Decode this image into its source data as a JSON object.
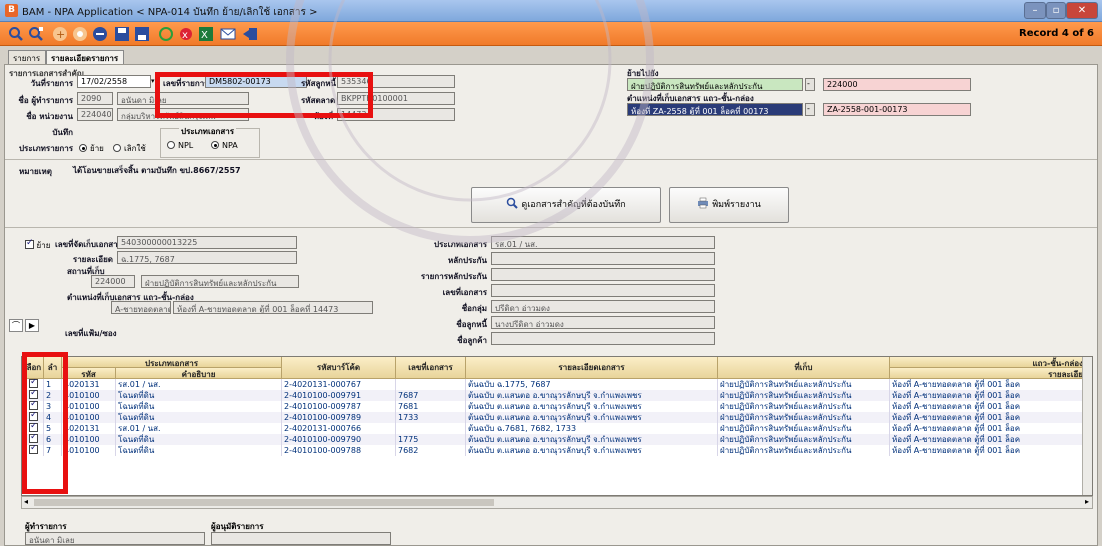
{
  "window": {
    "title": "BAM - NPA Application < NPA-014 บันทึก ย้าย/เลิกใช้ เอกสาร >"
  },
  "toolbar": {
    "record": "Record 4 of 6"
  },
  "tabs": [
    {
      "label": "รายการ"
    },
    {
      "label": "รายละเอียดรายการ"
    }
  ],
  "header": {
    "section_title": "รายการเอกสารสำคัญ",
    "date_label": "วันที่รายการ",
    "date_value": "17/02/2558",
    "docno_label": "เลขที่รายการ",
    "docno_value": "DM5802-00173",
    "operator_label": "ชื่อ ผู้ทำรายการ",
    "operator_code": "2090",
    "operator_name": "อนันดา มิเลย",
    "unit_label": "ชื่อ หน่วยงาน",
    "unit_code": "224040",
    "unit_name": "กลุ่มบริหารทรัพย์สินกรุงเทพ",
    "note_label": "บันทึก",
    "type_label": "ประเภทรายการ",
    "type_move": "ย้าย",
    "type_cancel": "เลิกใช้",
    "doctype_label": "ประเภทเอกสาร",
    "doctype_npl": "NPL",
    "doctype_npa": "NPA",
    "custcode_label": "รหัสลูกหนี้",
    "custcode_value": "535346",
    "market_label": "รหัสตลาด",
    "market_value": "BKPPTH0100001",
    "room_label": "ห้องที่",
    "room_value": "14473",
    "moveto_label": "ย้ายไปยัง",
    "moveto_unit": "ฝ่ายปฏิบัติการสินทรัพย์และหลักประกัน",
    "moveto_unit_code": "224000",
    "moveto_loc_label": "ตำแหน่งที่เก็บเอกสาร แถว-ชั้น-กล่อง",
    "moveto_loc": "ห้องที่ ZA-2558 ตู้ที่ 001 ล็อคที่ 00173",
    "moveto_loc_code": "ZA-2558-001-00173"
  },
  "remark": {
    "label": "หมายเหตุ",
    "value": "ได้โอนขายเสร็จสิ้น ตามบันทึก ขป.8667/2557"
  },
  "buttons": {
    "view_docs": "ดูเอกสารสำคัญที่ต้องบันทึก",
    "print": "พิมพ์รายงาน"
  },
  "detail": {
    "move_check": "ย้าย",
    "docstore_label": "เลขที่จัดเก็บเอกสาร",
    "docstore_value": "540300000013225",
    "detail_label": "รายละเอียด",
    "detail_value": "ฉ.1775, 7687",
    "place_label": "สถานที่เก็บ",
    "place_code": "224000",
    "place_name": "ฝ่ายปฏิบัติการสินทรัพย์และหลักประกัน",
    "loc_label": "ตำแหน่งที่เก็บเอกสาร แถว-ชั้น-กล่อง",
    "loc_value_a": "A-ชายทอดตลาด",
    "loc_value_b": "ห้องที่ A-ชายทอดตลาด ตู้ที่ 001 ล็อคที่ 14473",
    "folder_label": "เลขที่แฟ้ม/ซอง",
    "doctype_label": "ประเภทเอกสาร",
    "doctype_value": "รส.01 / นส.",
    "collat_label": "หลักประกัน",
    "collat_list_label": "รายการหลักประกัน",
    "docno_label": "เลขที่เอกสาร",
    "group_label": "ชื่อกลุ่ม",
    "group_value": "ปรีดิดา อ่าวมดง",
    "debtor_label": "ชื่อลูกหนี้",
    "debtor_value": "นางปรีดิดา อ่าวมดง",
    "customer_label": "ชื่อลูกค้า"
  },
  "grid": {
    "headers": {
      "select": "เลือก",
      "no": "ลำ",
      "doctype": "ประเภทเอกสาร",
      "code": "รหัส",
      "desc": "คำอธิบาย",
      "barcode": "รหัสบาร์โค้ด",
      "docno": "เลขที่เอกสาร",
      "docdetail": "รายละเอียดเอกสาร",
      "store": "ที่เก็บ",
      "loc": "แถว-ชั้น-กล่อง",
      "loc2": "รายละเอีย"
    },
    "rows": [
      {
        "no": "1",
        "code": "4020131",
        "desc": "รส.01 / นส.",
        "barcode": "2-4020131-000767",
        "docno": "",
        "detail": "ต้นฉบับ ฉ.1775, 7687",
        "store": "ฝ่ายปฏิบัติการสินทรัพย์และหลักประกัน",
        "loc": "ห้องที่ A-ชายทอดตลาด ตู้ที่ 001 ล็อค"
      },
      {
        "no": "2",
        "code": "4010100",
        "desc": "โฉนดที่ดิน",
        "barcode": "2-4010100-009791",
        "docno": "7687",
        "detail": "ต้นฉบับ ต.แสนตอ อ.ขาณุวรลักษบุรี จ.กำแพงเพชร",
        "store": "ฝ่ายปฏิบัติการสินทรัพย์และหลักประกัน",
        "loc": "ห้องที่ A-ชายทอดตลาด ตู้ที่ 001 ล็อค"
      },
      {
        "no": "3",
        "code": "4010100",
        "desc": "โฉนดที่ดิน",
        "barcode": "2-4010100-009787",
        "docno": "7681",
        "detail": "ต้นฉบับ ต.แสนตอ อ.ขาณุวรลักษบุรี จ.กำแพงเพชร",
        "store": "ฝ่ายปฏิบัติการสินทรัพย์และหลักประกัน",
        "loc": "ห้องที่ A-ชายทอดตลาด ตู้ที่ 001 ล็อค"
      },
      {
        "no": "4",
        "code": "4010100",
        "desc": "โฉนดที่ดิน",
        "barcode": "2-4010100-009789",
        "docno": "1733",
        "detail": "ต้นฉบับ ต.แสนตอ อ.ขาณุวรลักษบุรี จ.กำแพงเพชร",
        "store": "ฝ่ายปฏิบัติการสินทรัพย์และหลักประกัน",
        "loc": "ห้องที่ A-ชายทอดตลาด ตู้ที่ 001 ล็อค"
      },
      {
        "no": "5",
        "code": "4020131",
        "desc": "รส.01 / นส.",
        "barcode": "2-4020131-000766",
        "docno": "",
        "detail": "ต้นฉบับ ฉ.7681, 7682, 1733",
        "store": "ฝ่ายปฏิบัติการสินทรัพย์และหลักประกัน",
        "loc": "ห้องที่ A-ชายทอดตลาด ตู้ที่ 001 ล็อค"
      },
      {
        "no": "6",
        "code": "4010100",
        "desc": "โฉนดที่ดิน",
        "barcode": "2-4010100-009790",
        "docno": "1775",
        "detail": "ต้นฉบับ ต.แสนตอ อ.ขาณุวรลักษบุรี จ.กำแพงเพชร",
        "store": "ฝ่ายปฏิบัติการสินทรัพย์และหลักประกัน",
        "loc": "ห้องที่ A-ชายทอดตลาด ตู้ที่ 001 ล็อค"
      },
      {
        "no": "7",
        "code": "4010100",
        "desc": "โฉนดที่ดิน",
        "barcode": "2-4010100-009788",
        "docno": "7682",
        "detail": "ต้นฉบับ ต.แสนตอ อ.ขาณุวรลักษบุรี จ.กำแพงเพชร",
        "store": "ฝ่ายปฏิบัติการสินทรัพย์และหลักประกัน",
        "loc": "ห้องที่ A-ชายทอดตลาด ตู้ที่ 001 ล็อค"
      }
    ]
  },
  "footer": {
    "operator_label": "ผู้ทำรายการ",
    "operator_value": "อนันดา มิเลย",
    "approver_label": "ผู้อนุมัติรายการ"
  }
}
